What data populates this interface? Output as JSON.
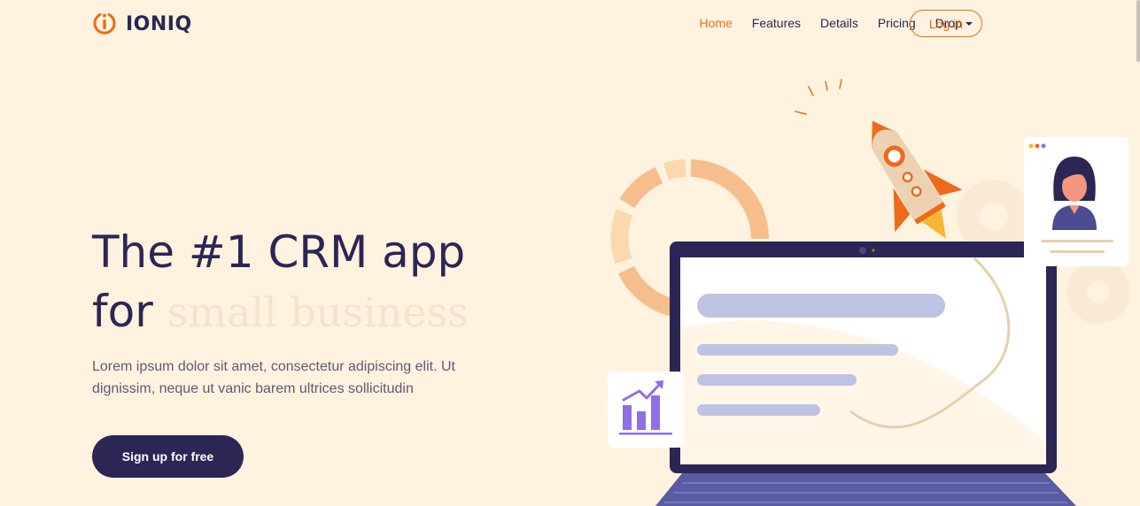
{
  "brand": {
    "name": "IONIQ",
    "logo_icon": "power-icon",
    "accent": "#ee6a1b"
  },
  "nav": {
    "items": [
      {
        "label": "Home",
        "active": true
      },
      {
        "label": "Features",
        "active": false
      },
      {
        "label": "Details",
        "active": false
      },
      {
        "label": "Pricing",
        "active": false
      },
      {
        "label": "Drop",
        "active": false,
        "dropdown": true
      }
    ],
    "login_label": "Log in"
  },
  "hero": {
    "title_line1": "The #1 CRM app",
    "title_line2": "for",
    "title_rotating": "small business",
    "description": "Lorem ipsum dolor sit amet, consectetur adipiscing elit. Ut dignissim, neque ut vanic barem ultrices sollicitudin",
    "cta_label": "Sign up for free"
  },
  "colors": {
    "background": "#fff3df",
    "primary_dark": "#2b2654",
    "accent_orange": "#ee6a1b",
    "lavender": "#bfc3e3"
  }
}
